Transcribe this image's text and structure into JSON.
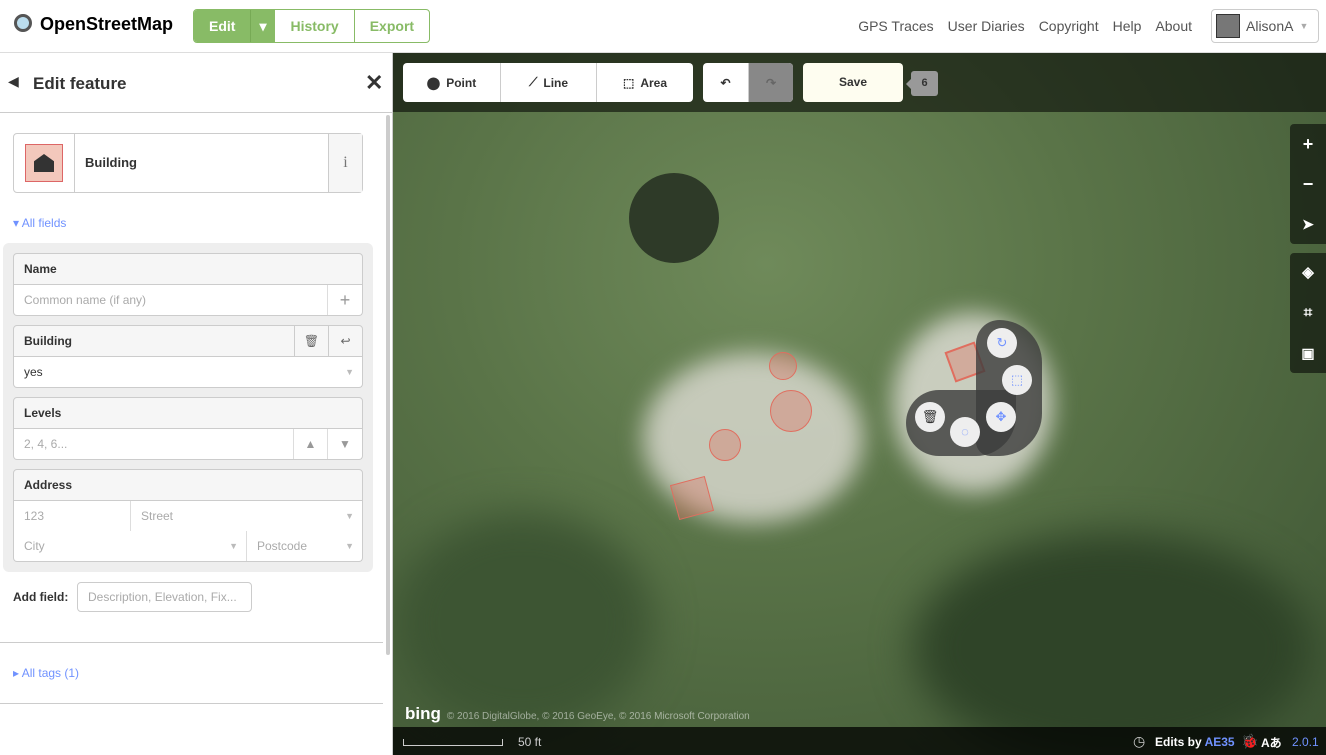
{
  "nav": {
    "brand": "OpenStreetMap",
    "edit": "Edit",
    "history": "History",
    "export": "Export",
    "links": [
      "GPS Traces",
      "User Diaries",
      "Copyright",
      "Help",
      "About"
    ],
    "user": "AlisonA"
  },
  "sidebar": {
    "title": "Edit feature",
    "preset": "Building",
    "all_fields": "All fields",
    "fields": {
      "name_label": "Name",
      "name_placeholder": "Common name (if any)",
      "building_label": "Building",
      "building_value": "yes",
      "levels_label": "Levels",
      "levels_placeholder": "2, 4, 6...",
      "address_label": "Address",
      "housenumber_placeholder": "123",
      "street_placeholder": "Street",
      "city_placeholder": "City",
      "postcode_placeholder": "Postcode"
    },
    "add_field_label": "Add field:",
    "add_field_placeholder": "Description, Elevation, Fix...",
    "all_tags": "All tags (1)"
  },
  "toolbar": {
    "point": "Point",
    "line": "Line",
    "area": "Area",
    "save": "Save",
    "edit_count": "6"
  },
  "map": {
    "attribution_logo": "bing",
    "attribution": "© 2016 DigitalGlobe, © 2016 GeoEye, © 2016 Microsoft Corporation",
    "scale": "50 ft",
    "edits_by_label": "Edits by",
    "edits_by_user": "AE35",
    "version": "2.0.1"
  },
  "colors": {
    "brand_green": "#8bb663",
    "link_blue": "#7092ff",
    "building_fill": "#e06e5f"
  }
}
